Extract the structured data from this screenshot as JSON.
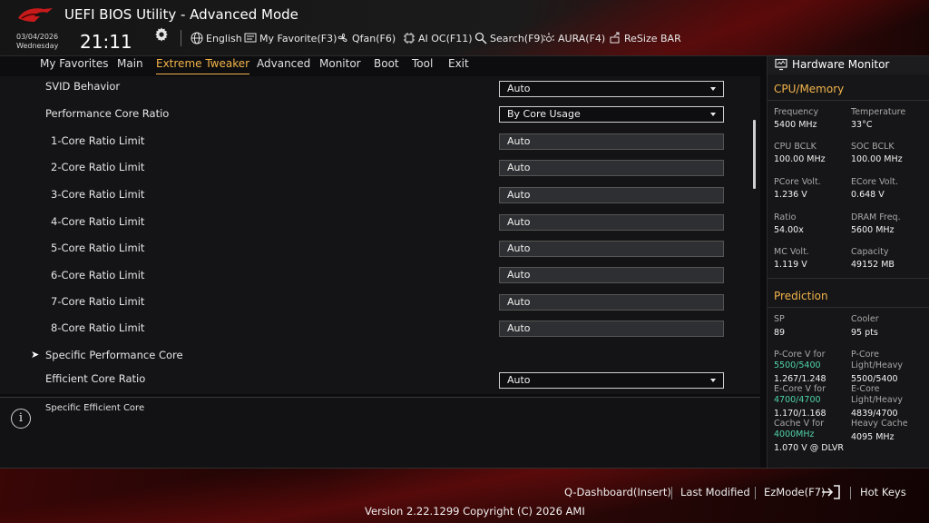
{
  "header": {
    "title": "UEFI BIOS Utility - Advanced Mode",
    "date": "03/04/2026",
    "weekday": "Wednesday",
    "time": "21:11",
    "buttons": [
      {
        "label": "English",
        "icon": "globe-icon"
      },
      {
        "label": "My Favorite(F3)",
        "icon": "favorite-icon"
      },
      {
        "label": "Qfan(F6)",
        "icon": "fan-icon"
      },
      {
        "label": "AI OC(F11)",
        "icon": "ai-chip-icon"
      },
      {
        "label": "Search(F9)",
        "icon": "search-icon"
      },
      {
        "label": "AURA(F4)",
        "icon": "aura-light-icon"
      },
      {
        "label": "ReSize BAR",
        "icon": "resize-bar-icon"
      }
    ]
  },
  "tabs": [
    "My Favorites",
    "Main",
    "Extreme Tweaker",
    "Advanced",
    "Monitor",
    "Boot",
    "Tool",
    "Exit"
  ],
  "active_tab": "Extreme Tweaker",
  "settings": [
    {
      "label": "SVID Behavior",
      "value": "Auto",
      "type": "dropdown"
    },
    {
      "label": "Performance Core Ratio",
      "value": "By Core Usage",
      "type": "dropdown"
    },
    {
      "label": "1-Core Ratio Limit",
      "value": "Auto",
      "type": "field"
    },
    {
      "label": "2-Core Ratio Limit",
      "value": "Auto",
      "type": "field"
    },
    {
      "label": "3-Core Ratio Limit",
      "value": "Auto",
      "type": "field"
    },
    {
      "label": "4-Core Ratio Limit",
      "value": "Auto",
      "type": "field"
    },
    {
      "label": "5-Core Ratio Limit",
      "value": "Auto",
      "type": "field"
    },
    {
      "label": "6-Core Ratio Limit",
      "value": "Auto",
      "type": "field"
    },
    {
      "label": "7-Core Ratio Limit",
      "value": "Auto",
      "type": "field"
    },
    {
      "label": "8-Core Ratio Limit",
      "value": "Auto",
      "type": "field"
    },
    {
      "label": "Specific Performance Core",
      "value": "",
      "type": "submenu"
    },
    {
      "label": "Efficient Core Ratio",
      "value": "Auto",
      "type": "dropdown"
    }
  ],
  "help": {
    "text": "Specific Efficient Core"
  },
  "hardware_monitor": {
    "title": "Hardware Monitor",
    "cpu_memory": {
      "section": "CPU/Memory",
      "items": [
        {
          "label": "Frequency",
          "value": "5400 MHz"
        },
        {
          "label": "Temperature",
          "value": "33°C"
        },
        {
          "label": "CPU BCLK",
          "value": "100.00 MHz"
        },
        {
          "label": "SOC BCLK",
          "value": "100.00 MHz"
        },
        {
          "label": "PCore Volt.",
          "value": "1.236 V"
        },
        {
          "label": "ECore Volt.",
          "value": "0.648 V"
        },
        {
          "label": "Ratio",
          "value": "54.00x"
        },
        {
          "label": "DRAM Freq.",
          "value": "5600 MHz"
        },
        {
          "label": "MC Volt.",
          "value": "1.119 V"
        },
        {
          "label": "Capacity",
          "value": "49152 MB"
        }
      ]
    },
    "prediction": {
      "section": "Prediction",
      "sp_label": "SP",
      "sp_value": "89",
      "cooler_label": "Cooler",
      "cooler_value": "95 pts",
      "pcore_v_label": "P-Core V for",
      "pcore_v_freq": "5500/5400",
      "pcore_v_value": "1.267/1.248",
      "pcore_lh_label_1": "P-Core",
      "pcore_lh_label_2": "Light/Heavy",
      "pcore_lh_value": "5500/5400",
      "ecore_v_label": "E-Core V for",
      "ecore_v_freq": "4700/4700",
      "ecore_v_value": "1.170/1.168",
      "ecore_lh_label_1": "E-Core",
      "ecore_lh_label_2": "Light/Heavy",
      "ecore_lh_value": "4839/4700",
      "cache_v_label": "Cache V for",
      "cache_v_freq": "4000MHz",
      "cache_v_value": "1.070 V @ DLVR",
      "heavy_cache_label": "Heavy Cache",
      "heavy_cache_value": "4095 MHz"
    }
  },
  "footer": {
    "buttons": [
      "Q-Dashboard(Insert)",
      "Last Modified",
      "EzMode(F7)",
      "Hot Keys"
    ],
    "version": "Version 2.22.1299 Copyright (C) 2026 AMI"
  },
  "colors": {
    "accent": "#f3b44a",
    "prediction_green": "#4fd2a8",
    "brand_red": "#b81414"
  }
}
